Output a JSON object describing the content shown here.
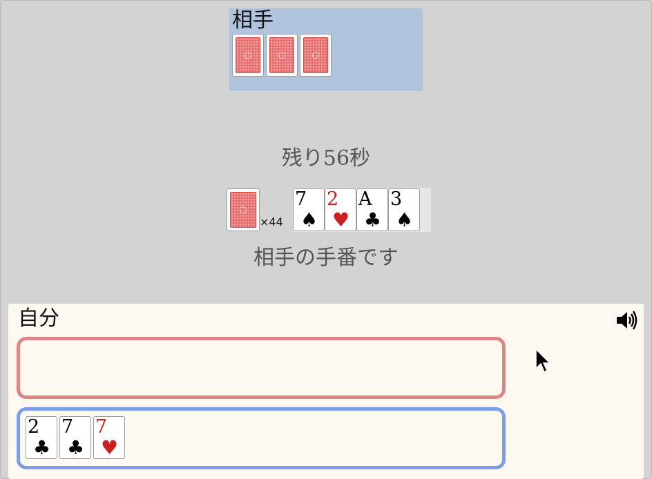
{
  "opponent": {
    "label": "相手",
    "hand_count": 3
  },
  "timer": {
    "text": "残り56秒"
  },
  "deck": {
    "count_label": "×44"
  },
  "field": {
    "cards": [
      {
        "rank": "7",
        "suit": "♠",
        "color": "#000000"
      },
      {
        "rank": "2",
        "suit": "♥",
        "color": "#cc1f1f"
      },
      {
        "rank": "A",
        "suit": "♣",
        "color": "#000000"
      },
      {
        "rank": "3",
        "suit": "♠",
        "color": "#000000"
      }
    ]
  },
  "status": {
    "turn_text": "相手の手番です"
  },
  "self": {
    "label": "自分",
    "sound_icon": "speaker-volume-icon",
    "hand": [
      {
        "rank": "2",
        "suit": "♣",
        "color": "#000000"
      },
      {
        "rank": "7",
        "suit": "♣",
        "color": "#000000"
      },
      {
        "rank": "7",
        "suit": "♥",
        "color": "#cc1f1f"
      }
    ]
  },
  "colors": {
    "background": "#d3d3d3",
    "opponent_area": "#b0c4de",
    "self_area": "#fdf8f0",
    "red_zone_border": "#e08585",
    "blue_zone_border": "#7b9ee6",
    "card_back": "#ea6c6c"
  }
}
